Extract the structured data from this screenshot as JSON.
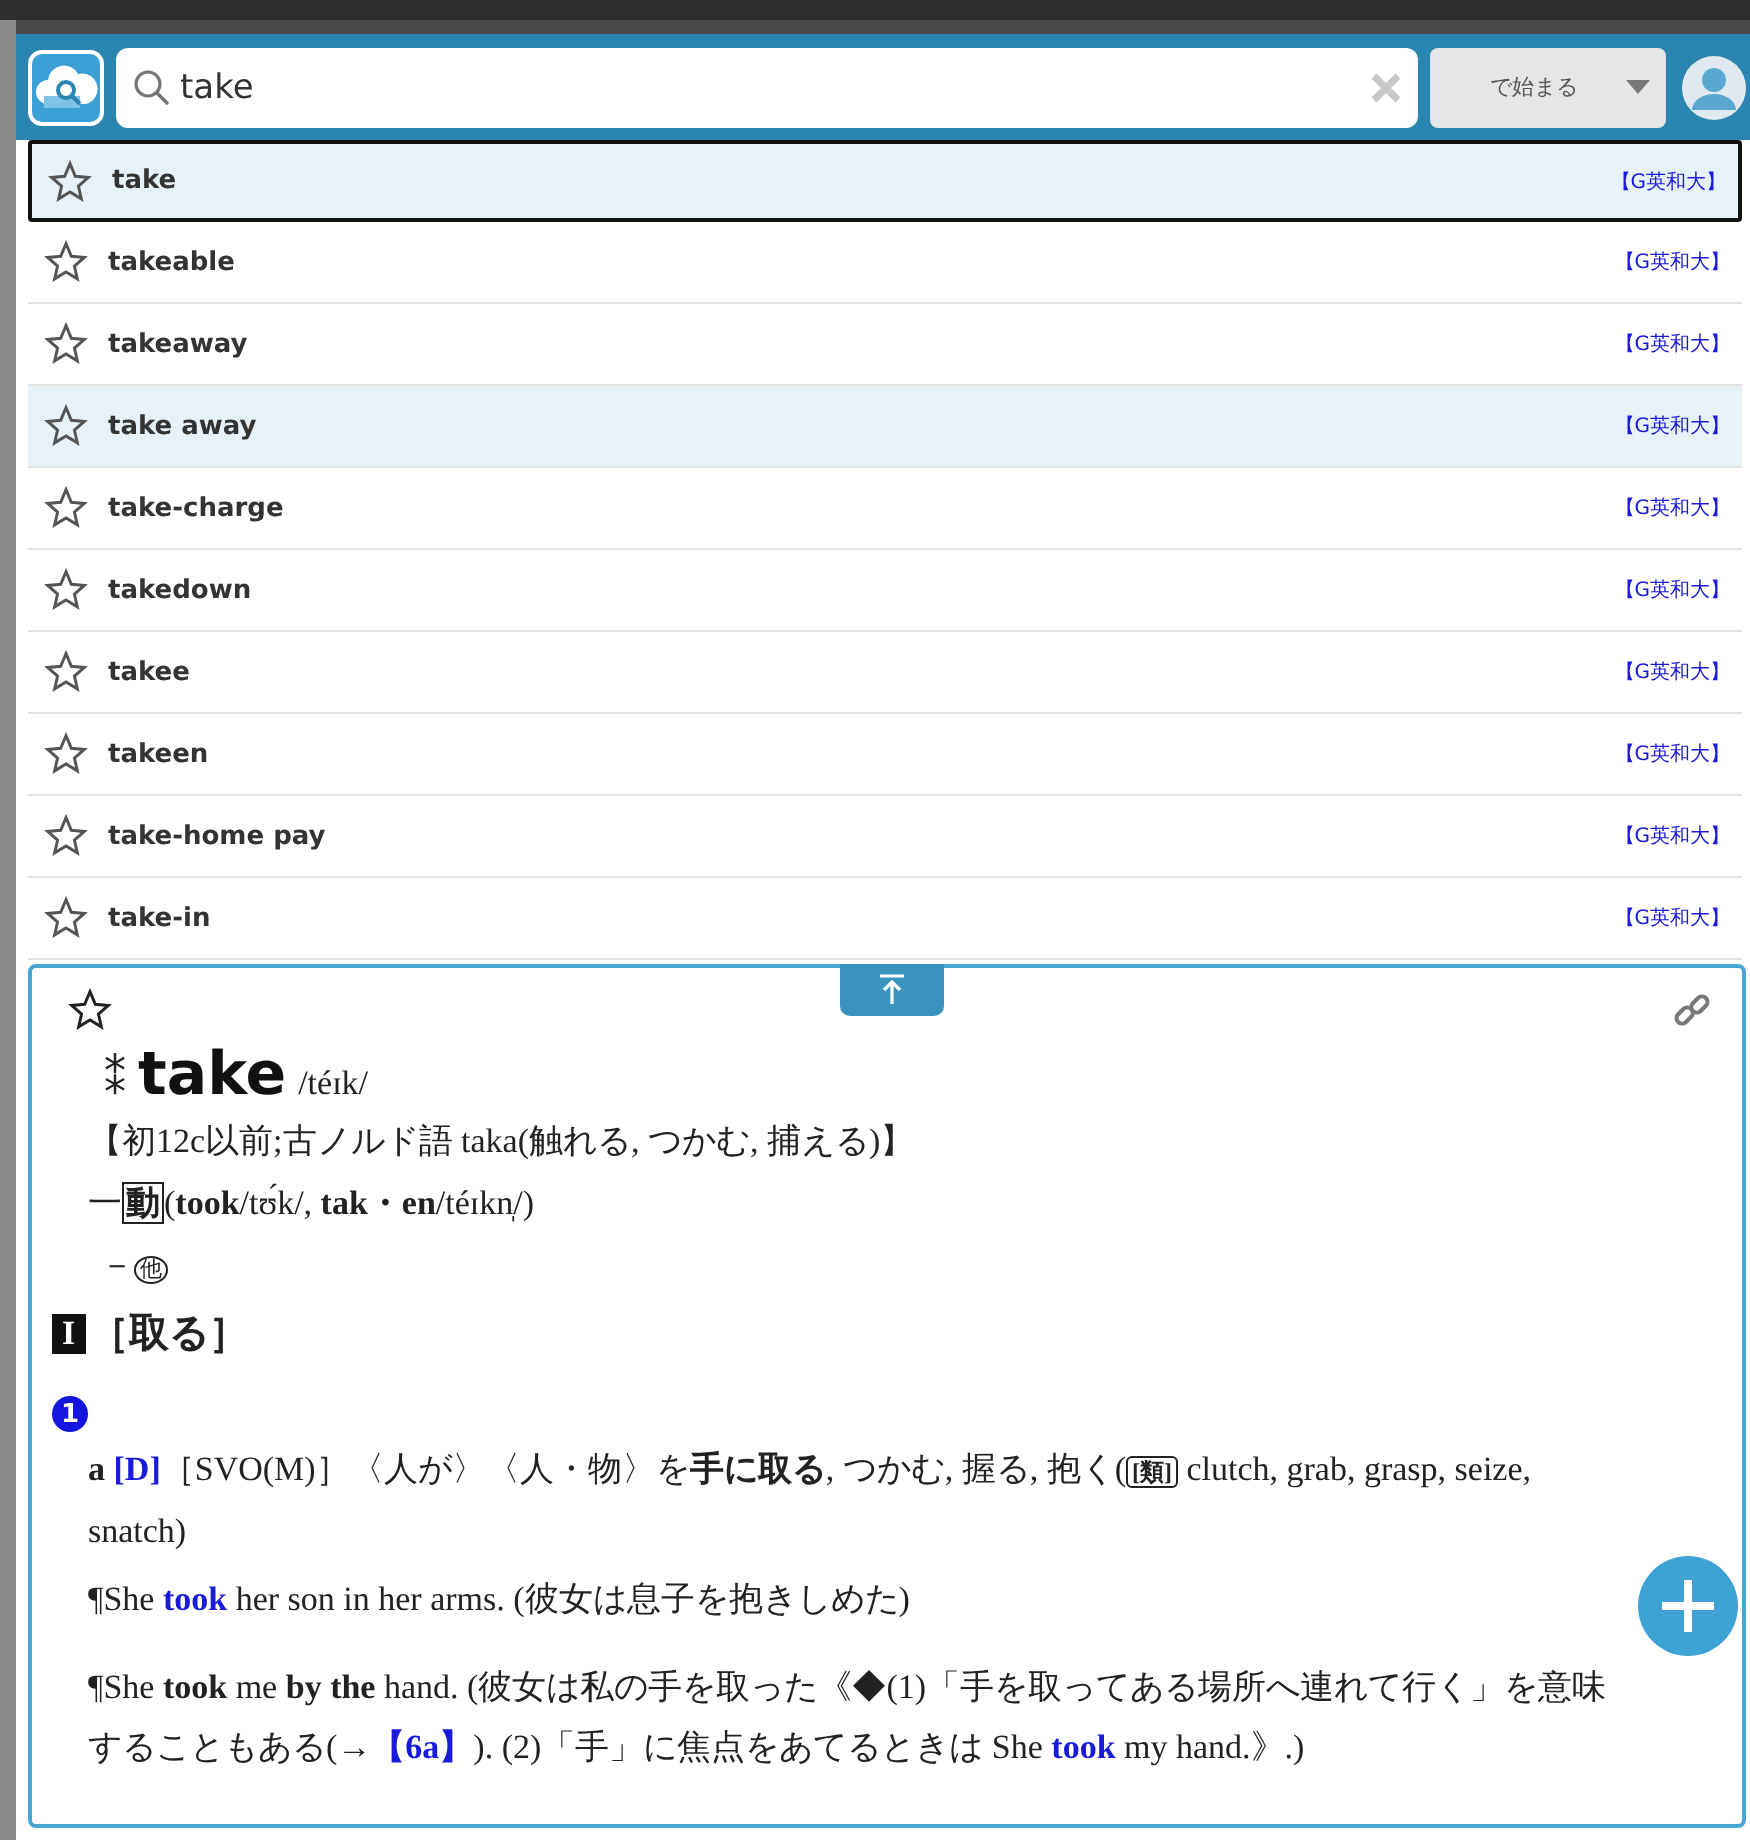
{
  "search": {
    "value": "take",
    "mode": "で始まる"
  },
  "results": [
    {
      "word": "take",
      "source": "【G英和大】",
      "selected": true,
      "highlighted": false
    },
    {
      "word": "takeable",
      "source": "【G英和大】",
      "selected": false,
      "highlighted": false
    },
    {
      "word": "takeaway",
      "source": "【G英和大】",
      "selected": false,
      "highlighted": false
    },
    {
      "word": "take away",
      "source": "【G英和大】",
      "selected": false,
      "highlighted": true
    },
    {
      "word": "take-charge",
      "source": "【G英和大】",
      "selected": false,
      "highlighted": false
    },
    {
      "word": "takedown",
      "source": "【G英和大】",
      "selected": false,
      "highlighted": false
    },
    {
      "word": "takee",
      "source": "【G英和大】",
      "selected": false,
      "highlighted": false
    },
    {
      "word": "takeen",
      "source": "【G英和大】",
      "selected": false,
      "highlighted": false
    },
    {
      "word": "take-home pay",
      "source": "【G英和大】",
      "selected": false,
      "highlighted": false
    },
    {
      "word": "take-in",
      "source": "【G英和大】",
      "selected": false,
      "highlighted": false
    }
  ],
  "entry": {
    "mark": "⁑",
    "headword": "take",
    "pronunciation": "/téɪk/",
    "lines": [
      {
        "kind": "etymology",
        "segments": [
          {
            "kind": "plain",
            "text": "【初12c以前;古ノルド語 taka(触れる, つかむ, 捕える)】"
          }
        ]
      },
      {
        "kind": "forms",
        "segments": [
          {
            "kind": "plain",
            "text": "一"
          },
          {
            "kind": "boxed",
            "text": "動"
          },
          {
            "kind": "plain",
            "text": "("
          },
          {
            "kind": "bold",
            "text": "took"
          },
          {
            "kind": "plain",
            "text": "/tʊ́k/, "
          },
          {
            "kind": "bold",
            "text": "tak・en"
          },
          {
            "kind": "plain",
            "text": "/téɪkn̩/)"
          }
        ]
      },
      {
        "kind": "pos",
        "segments": [
          {
            "kind": "plain",
            "text": "－"
          },
          {
            "kind": "circled",
            "text": "他"
          }
        ]
      }
    ],
    "section": {
      "number": "I",
      "title": "［取る］"
    },
    "sense": "1",
    "paragraphs": [
      {
        "kind": "definition",
        "segments": [
          {
            "kind": "bold",
            "text": "a "
          },
          {
            "kind": "link",
            "text": "[D]"
          },
          {
            "kind": "plain",
            "text": "［SVO(M)］〈人が〉〈人・物〉を"
          },
          {
            "kind": "bold",
            "text": "手に取る"
          },
          {
            "kind": "plain",
            "text": ", つかむ, 握る, 抱く("
          },
          {
            "kind": "tag",
            "text": "[類]"
          },
          {
            "kind": "plain",
            "text": " clutch, grab, grasp, seize, snatch)"
          }
        ]
      },
      {
        "kind": "example",
        "segments": [
          {
            "kind": "plain",
            "text": "¶She "
          },
          {
            "kind": "link",
            "text": "took"
          },
          {
            "kind": "plain",
            "text": " her son in her arms. (彼女は息子を抱きしめた)"
          }
        ]
      },
      {
        "kind": "example",
        "segments": [
          {
            "kind": "plain",
            "text": "¶She "
          },
          {
            "kind": "bold",
            "text": "took"
          },
          {
            "kind": "plain",
            "text": " me "
          },
          {
            "kind": "bold",
            "text": "by the"
          },
          {
            "kind": "plain",
            "text": " hand. (彼女は私の手を取った《◆(1)「手を取ってある場所へ連れて行く」を意味することもある(→"
          },
          {
            "kind": "link",
            "text": "【6a】"
          },
          {
            "kind": "plain",
            "text": "). (2)「手」に焦点をあてるときは She "
          },
          {
            "kind": "link",
            "text": "took"
          },
          {
            "kind": "plain",
            "text": " my hand.》.)"
          }
        ]
      }
    ]
  }
}
